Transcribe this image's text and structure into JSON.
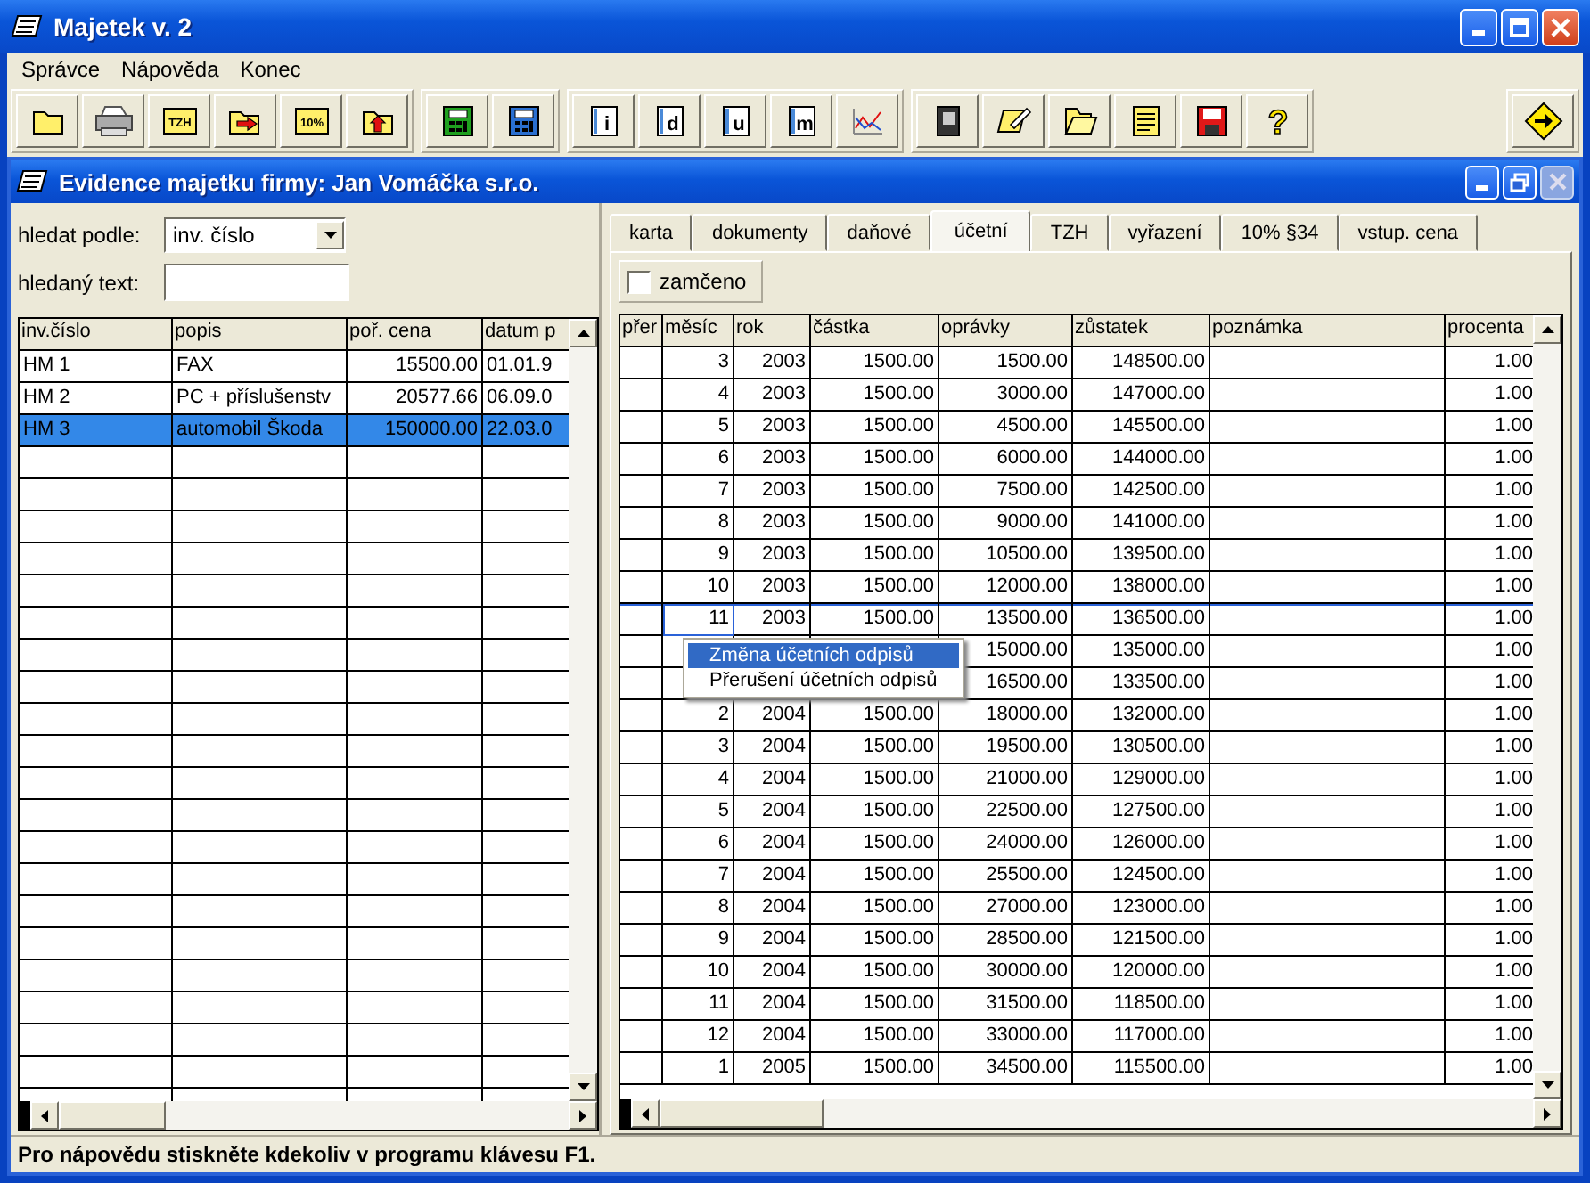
{
  "window": {
    "title": "Majetek v. 2"
  },
  "menu": [
    "Správce",
    "Nápověda",
    "Konec"
  ],
  "toolbar": [
    [
      {
        "kind": "folder"
      },
      {
        "kind": "printer"
      },
      {
        "kind": "tag",
        "label": "TZH"
      },
      {
        "kind": "folder-arrow"
      },
      {
        "kind": "tag",
        "label": "10%"
      },
      {
        "kind": "folder-up"
      }
    ],
    [
      {
        "kind": "calculator",
        "color": "#1fa01f"
      },
      {
        "kind": "calculator",
        "color": "#2a6fd0"
      }
    ],
    [
      {
        "kind": "document",
        "label": "i"
      },
      {
        "kind": "document",
        "label": "d"
      },
      {
        "kind": "document",
        "label": "u"
      },
      {
        "kind": "document",
        "label": "m"
      },
      {
        "kind": "chart"
      }
    ],
    [
      {
        "kind": "book"
      },
      {
        "kind": "notepad"
      },
      {
        "kind": "folder-open"
      },
      {
        "kind": "note"
      },
      {
        "kind": "floppy"
      },
      {
        "kind": "question",
        "label": "?"
      }
    ],
    [
      {
        "kind": "exit"
      }
    ]
  ],
  "document": {
    "title": "Evidence majetku firmy: Jan Vomáčka s.r.o."
  },
  "search": {
    "by_label": "hledat podle:",
    "by_value": "inv. číslo",
    "text_label": "hledaný text:"
  },
  "assets": {
    "columns": [
      "inv.číslo",
      "popis",
      "poř. cena",
      "datum p"
    ],
    "rows": [
      {
        "cells": [
          "HM 1",
          "FAX",
          "15500.00",
          "01.01.9"
        ],
        "selected": false
      },
      {
        "cells": [
          "HM 2",
          "PC + příslušenstv",
          "20577.66",
          "06.09.0"
        ],
        "selected": false
      },
      {
        "cells": [
          "HM 3",
          "automobil Škoda",
          "150000.00",
          "22.03.0"
        ],
        "selected": true
      }
    ]
  },
  "tabs": [
    {
      "label": "karta",
      "selected": false
    },
    {
      "label": "dokumenty",
      "selected": false
    },
    {
      "label": "daňové",
      "selected": false
    },
    {
      "label": "účetní",
      "selected": true
    },
    {
      "label": "TZH",
      "selected": false
    },
    {
      "label": "vyřazení",
      "selected": false
    },
    {
      "label": "10% §34",
      "selected": false
    },
    {
      "label": "vstup. cena",
      "selected": false
    }
  ],
  "locked": {
    "label": "zamčeno",
    "checked": false
  },
  "depreciation": {
    "columns": [
      "přer",
      "měsíc",
      "rok",
      "částka",
      "oprávky",
      "zůstatek",
      "poznámka",
      "procenta"
    ],
    "rows": [
      {
        "month": "3",
        "year": "2003",
        "amount": "1500.00",
        "accumulated": "1500.00",
        "remaining": "148500.00",
        "percent": "1.00",
        "selected": false
      },
      {
        "month": "4",
        "year": "2003",
        "amount": "1500.00",
        "accumulated": "3000.00",
        "remaining": "147000.00",
        "percent": "1.00",
        "selected": false
      },
      {
        "month": "5",
        "year": "2003",
        "amount": "1500.00",
        "accumulated": "4500.00",
        "remaining": "145500.00",
        "percent": "1.00",
        "selected": false
      },
      {
        "month": "6",
        "year": "2003",
        "amount": "1500.00",
        "accumulated": "6000.00",
        "remaining": "144000.00",
        "percent": "1.00",
        "selected": false
      },
      {
        "month": "7",
        "year": "2003",
        "amount": "1500.00",
        "accumulated": "7500.00",
        "remaining": "142500.00",
        "percent": "1.00",
        "selected": false
      },
      {
        "month": "8",
        "year": "2003",
        "amount": "1500.00",
        "accumulated": "9000.00",
        "remaining": "141000.00",
        "percent": "1.00",
        "selected": false
      },
      {
        "month": "9",
        "year": "2003",
        "amount": "1500.00",
        "accumulated": "10500.00",
        "remaining": "139500.00",
        "percent": "1.00",
        "selected": false
      },
      {
        "month": "10",
        "year": "2003",
        "amount": "1500.00",
        "accumulated": "12000.00",
        "remaining": "138000.00",
        "percent": "1.00",
        "selected": false
      },
      {
        "month": "11",
        "year": "2003",
        "amount": "1500.00",
        "accumulated": "13500.00",
        "remaining": "136500.00",
        "percent": "1.00",
        "selected": true
      },
      {
        "accumulated": "15000.00",
        "remaining": "135000.00",
        "percent": "1.00",
        "selected": false
      },
      {
        "accumulated": "16500.00",
        "remaining": "133500.00",
        "percent": "1.00",
        "selected": false
      },
      {
        "month": "2",
        "year": "2004",
        "amount": "1500.00",
        "accumulated": "18000.00",
        "remaining": "132000.00",
        "percent": "1.00",
        "selected": false
      },
      {
        "month": "3",
        "year": "2004",
        "amount": "1500.00",
        "accumulated": "19500.00",
        "remaining": "130500.00",
        "percent": "1.00",
        "selected": false
      },
      {
        "month": "4",
        "year": "2004",
        "amount": "1500.00",
        "accumulated": "21000.00",
        "remaining": "129000.00",
        "percent": "1.00",
        "selected": false
      },
      {
        "month": "5",
        "year": "2004",
        "amount": "1500.00",
        "accumulated": "22500.00",
        "remaining": "127500.00",
        "percent": "1.00",
        "selected": false
      },
      {
        "month": "6",
        "year": "2004",
        "amount": "1500.00",
        "accumulated": "24000.00",
        "remaining": "126000.00",
        "percent": "1.00",
        "selected": false
      },
      {
        "month": "7",
        "year": "2004",
        "amount": "1500.00",
        "accumulated": "25500.00",
        "remaining": "124500.00",
        "percent": "1.00",
        "selected": false
      },
      {
        "month": "8",
        "year": "2004",
        "amount": "1500.00",
        "accumulated": "27000.00",
        "remaining": "123000.00",
        "percent": "1.00",
        "selected": false
      },
      {
        "month": "9",
        "year": "2004",
        "amount": "1500.00",
        "accumulated": "28500.00",
        "remaining": "121500.00",
        "percent": "1.00",
        "selected": false
      },
      {
        "month": "10",
        "year": "2004",
        "amount": "1500.00",
        "accumulated": "30000.00",
        "remaining": "120000.00",
        "percent": "1.00",
        "selected": false
      },
      {
        "month": "11",
        "year": "2004",
        "amount": "1500.00",
        "accumulated": "31500.00",
        "remaining": "118500.00",
        "percent": "1.00",
        "selected": false
      },
      {
        "month": "12",
        "year": "2004",
        "amount": "1500.00",
        "accumulated": "33000.00",
        "remaining": "117000.00",
        "percent": "1.00",
        "selected": false
      },
      {
        "month": "1",
        "year": "2005",
        "amount": "1500.00",
        "accumulated": "34500.00",
        "remaining": "115500.00",
        "percent": "1.00",
        "selected": false
      }
    ]
  },
  "context_menu": {
    "items": [
      {
        "label": "Změna účetních odpisů",
        "selected": true
      },
      {
        "label": "Přerušení účetních odpisů",
        "selected": false
      }
    ]
  },
  "status_bar": "Pro nápovědu stiskněte kdekoliv v programu klávesu F1."
}
